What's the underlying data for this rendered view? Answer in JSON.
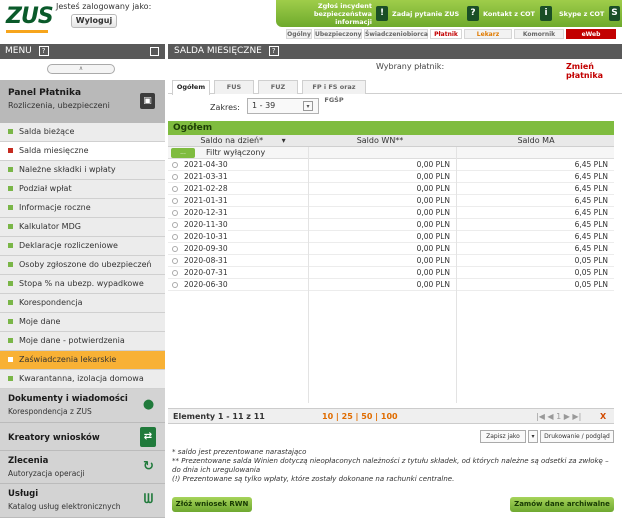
{
  "header": {
    "logo_text": "ZUS",
    "logged_in_label": "Jesteś zalogowany jako:",
    "logout_label": "Wyloguj",
    "top_links": [
      {
        "label": "Zgłoś incydent bezpieczeństwa informacji",
        "icon": "warning-icon"
      },
      {
        "label": "Zadaj pytanie ZUS",
        "icon": "question-icon"
      },
      {
        "label": "Kontakt z COT",
        "icon": "info-icon"
      },
      {
        "label": "Skype z COT",
        "icon": "skype-icon"
      }
    ],
    "nav_tabs": [
      "Ogólny",
      "Ubezpieczony",
      "Świadczeniobiorca",
      "Płatnik",
      "Lekarz",
      "Komornik",
      "eWeb"
    ]
  },
  "sidebar": {
    "menu_title": "MENU",
    "help_icon": "?",
    "scroll_label": "∧",
    "panel": {
      "title": "Panel Płatnika",
      "subtitle": "Rozliczenia, ubezpieczeni"
    },
    "items": [
      {
        "label": "Salda bieżące",
        "state": "normal"
      },
      {
        "label": "Salda miesięczne",
        "state": "active"
      },
      {
        "label": "Należne składki i wpłaty",
        "state": "normal"
      },
      {
        "label": "Podział wpłat",
        "state": "normal"
      },
      {
        "label": "Informacje roczne",
        "state": "normal"
      },
      {
        "label": "Kalkulator MDG",
        "state": "normal"
      },
      {
        "label": "Deklaracje rozliczeniowe",
        "state": "normal"
      },
      {
        "label": "Osoby zgłoszone do ubezpieczeń",
        "state": "normal"
      },
      {
        "label": "Stopa % na ubezp. wypadkowe",
        "state": "normal"
      },
      {
        "label": "Korespondencja",
        "state": "normal"
      },
      {
        "label": "Moje dane",
        "state": "normal"
      },
      {
        "label": "Moje dane - potwierdzenia",
        "state": "normal"
      },
      {
        "label": "Zaświadczenia lekarskie",
        "state": "highlight"
      },
      {
        "label": "Kwarantanna, izolacja domowa",
        "state": "normal"
      }
    ],
    "sections": [
      {
        "title": "Dokumenty i wiadomości",
        "subtitle": "Korespondencja z ZUS",
        "icon": "chat-icon"
      },
      {
        "title": "Kreatory wniosków",
        "subtitle": "",
        "icon": "form-icon"
      },
      {
        "title": "Zlecenia",
        "subtitle": "Autoryzacja operacji",
        "icon": "refresh-icon"
      },
      {
        "title": "Usługi",
        "subtitle": "Katalog usług elektronicznych",
        "icon": "tools-icon"
      }
    ]
  },
  "main": {
    "title": "SALDA MIESIĘCZNE",
    "payer_label": "Wybrany płatnik:",
    "change_payer": "Zmień płatnika",
    "tabs": [
      "Ogółem",
      "FUS",
      "FUZ",
      "FP i FS oraz FGŚP"
    ],
    "zakres_label": "Zakres:",
    "zakres_value": "1 - 39",
    "grid_title": "Ogółem",
    "columns": [
      "Saldo na dzień*",
      "Saldo WN**",
      "Saldo MA"
    ],
    "filter_btn": "...",
    "filter_text": "Filtr wyłączony",
    "rows": [
      [
        "2021-04-30",
        "0,00 PLN",
        "6,45 PLN"
      ],
      [
        "2021-03-31",
        "0,00 PLN",
        "6,45 PLN"
      ],
      [
        "2021-02-28",
        "0,00 PLN",
        "6,45 PLN"
      ],
      [
        "2021-01-31",
        "0,00 PLN",
        "6,45 PLN"
      ],
      [
        "2020-12-31",
        "0,00 PLN",
        "6,45 PLN"
      ],
      [
        "2020-11-30",
        "0,00 PLN",
        "6,45 PLN"
      ],
      [
        "2020-10-31",
        "0,00 PLN",
        "6,45 PLN"
      ],
      [
        "2020-09-30",
        "0,00 PLN",
        "6,45 PLN"
      ],
      [
        "2020-08-31",
        "0,00 PLN",
        "0,05 PLN"
      ],
      [
        "2020-07-31",
        "0,00 PLN",
        "0,05 PLN"
      ],
      [
        "2020-06-30",
        "0,00 PLN",
        "0,05 PLN"
      ]
    ],
    "pager": {
      "count": "Elementy 1 - 11 z 11",
      "sizes": "10 | 25 | 50 | 100",
      "nav": "|◀ ◀   1   ▶ ▶|",
      "excel": "X"
    },
    "save_as": "Zapisz jako",
    "print_btn": "Drukowanie / podgląd",
    "notes": [
      "* saldo jest prezentowane narastająco",
      "** Prezentowane salda Winien dotyczą nieopłaconych należności z tytułu składek, od których należne są odsetki za zwłokę – do dnia ich uregulowania",
      "(!) Prezentowane są tylko wpłaty, które zostały dokonane na rachunki centralne."
    ],
    "btn_rwn": "Złóż wniosek RWN",
    "btn_archive": "Zamów dane archiwalne"
  },
  "colors": {
    "brand_green": "#7fbc3f",
    "accent_red": "#c20000",
    "highlight_orange": "#f8b135",
    "dark_bar": "#595959"
  }
}
